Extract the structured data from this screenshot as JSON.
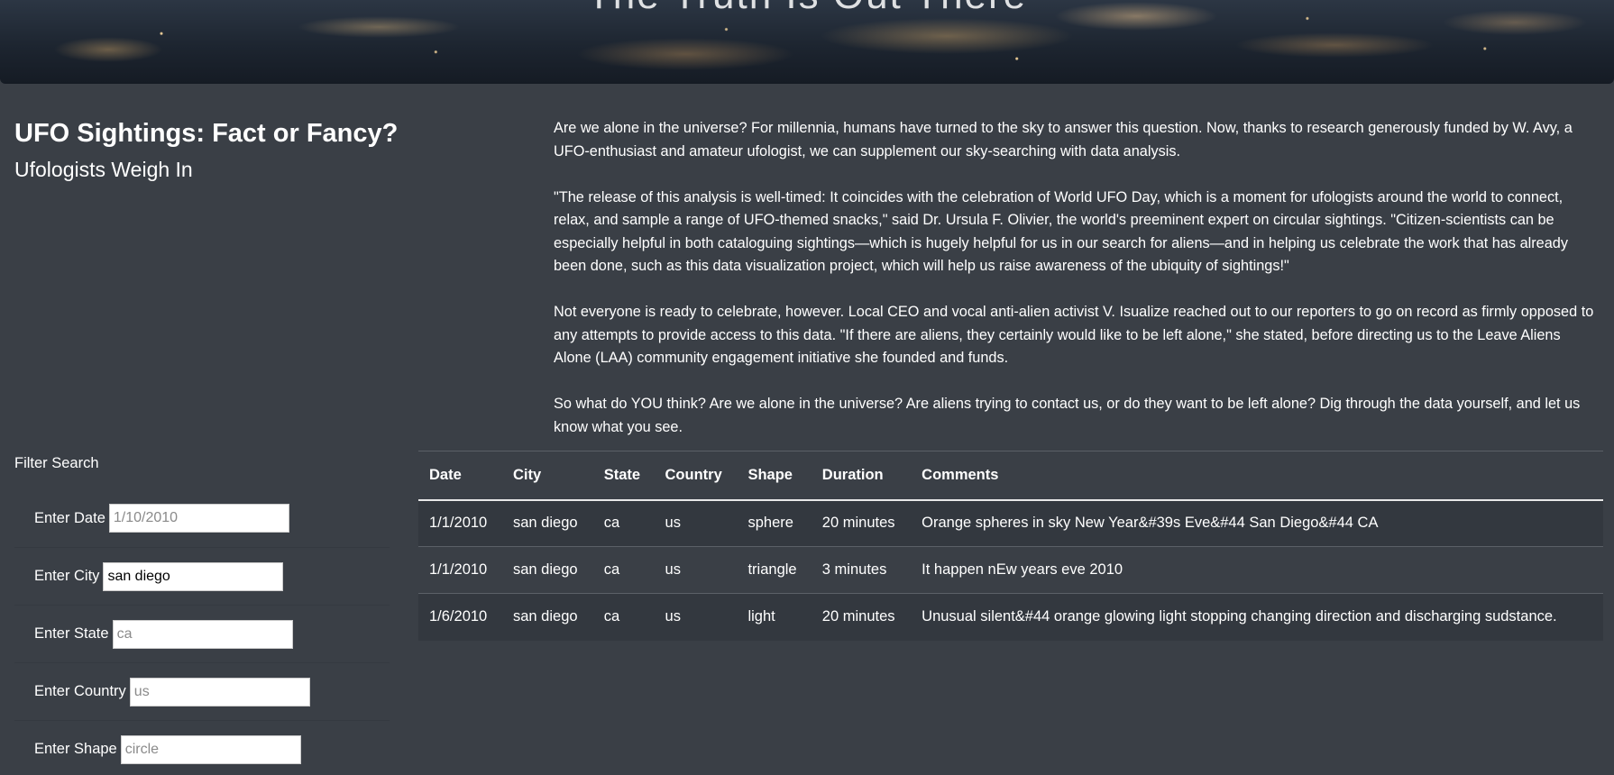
{
  "hero": {
    "title": "The Truth Is Out There"
  },
  "heading": {
    "main": "UFO Sightings: Fact or Fancy?",
    "sub": "Ufologists Weigh In"
  },
  "article": {
    "paragraphs": [
      "Are we alone in the universe? For millennia, humans have turned to the sky to answer this question. Now, thanks to research generously funded by W. Avy, a UFO-enthusiast and amateur ufologist, we can supplement our sky-searching with data analysis.",
      "\"The release of this analysis is well-timed: It coincides with the celebration of World UFO Day, which is a moment for ufologists around the world to connect, relax, and sample a range of UFO-themed snacks,\" said Dr. Ursula F. Olivier, the world's preeminent expert on circular sightings. \"Citizen-scientists can be especially helpful in both cataloguing sightings—which is hugely helpful for us in our search for aliens—and in helping us celebrate the work that has already been done, such as this data visualization project, which will help us raise awareness of the ubiquity of sightings!\"",
      "Not everyone is ready to celebrate, however. Local CEO and vocal anti-alien activist V. Isualize reached out to our reporters to go on record as firmly opposed to any attempts to provide access to this data. \"If there are aliens, they certainly would like to be left alone,\" she stated, before directing us to the Leave Aliens Alone (LAA) community engagement initiative she founded and funds.",
      "So what do YOU think? Are we alone in the universe? Are aliens trying to contact us, or do they want to be left alone? Dig through the data yourself, and let us know what you see."
    ]
  },
  "filters": {
    "title": "Filter Search",
    "date": {
      "label": "Enter Date",
      "value": "",
      "placeholder": "1/10/2010"
    },
    "city": {
      "label": "Enter City",
      "value": "san diego",
      "placeholder": ""
    },
    "state": {
      "label": "Enter State",
      "value": "",
      "placeholder": "ca"
    },
    "country": {
      "label": "Enter Country",
      "value": "",
      "placeholder": "us"
    },
    "shape": {
      "label": "Enter Shape",
      "value": "",
      "placeholder": "circle"
    }
  },
  "table": {
    "headers": [
      "Date",
      "City",
      "State",
      "Country",
      "Shape",
      "Duration",
      "Comments"
    ],
    "rows": [
      [
        "1/1/2010",
        "san diego",
        "ca",
        "us",
        "sphere",
        "20 minutes",
        "Orange spheres in sky New Year&#39s Eve&#44 San Diego&#44 CA"
      ],
      [
        "1/1/2010",
        "san diego",
        "ca",
        "us",
        "triangle",
        "3 minutes",
        "It happen nEw years eve 2010"
      ],
      [
        "1/6/2010",
        "san diego",
        "ca",
        "us",
        "light",
        "20 minutes",
        "Unusual silent&#44 orange glowing light stopping changing direction and discharging sudstance."
      ]
    ]
  }
}
